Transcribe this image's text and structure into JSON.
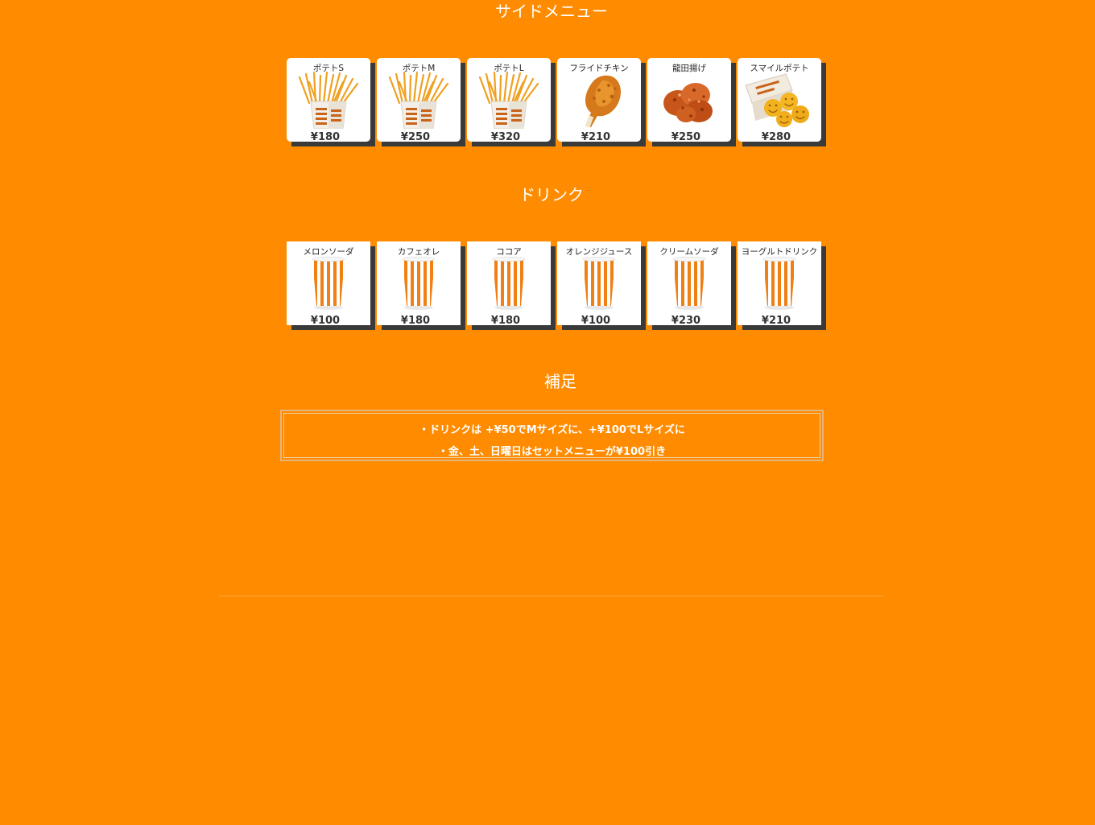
{
  "sections": {
    "side_title": "サイドメニュー",
    "drink_title": "ドリンク",
    "note_title": "補足"
  },
  "side_items": [
    {
      "name": "ポテトS",
      "price": "¥180",
      "icon": "fries-icon"
    },
    {
      "name": "ポテトM",
      "price": "¥250",
      "icon": "fries-icon"
    },
    {
      "name": "ポテトL",
      "price": "¥320",
      "icon": "fries-icon"
    },
    {
      "name": "フライドチキン",
      "price": "¥210",
      "icon": "fried-chicken-icon"
    },
    {
      "name": "龍田揚げ",
      "price": "¥250",
      "icon": "tatsuta-age-icon"
    },
    {
      "name": "スマイルポテト",
      "price": "¥280",
      "icon": "smile-potato-icon"
    }
  ],
  "drink_items": [
    {
      "name": "メロンソーダ",
      "price": "¥100",
      "icon": "striped-cup-icon"
    },
    {
      "name": "カフェオレ",
      "price": "¥180",
      "icon": "striped-cup-icon"
    },
    {
      "name": "ココア",
      "price": "¥180",
      "icon": "striped-cup-icon"
    },
    {
      "name": "オレンジジュース",
      "price": "¥100",
      "icon": "striped-cup-icon"
    },
    {
      "name": "クリームソーダ",
      "price": "¥230",
      "icon": "striped-cup-icon"
    },
    {
      "name": "ヨーグルトドリンク",
      "price": "¥210",
      "icon": "striped-cup-icon"
    }
  ],
  "notes": [
    "・ドリンクは +¥50でMサイズに、+¥100でLサイズに",
    "・金、土、日曜日はセットメニューが¥100引き"
  ],
  "colors": {
    "background": "#FF8C00",
    "card": "#FFFFFF",
    "shadow": "#3A3A3A",
    "text_on_bg": "#FFFFFF"
  }
}
